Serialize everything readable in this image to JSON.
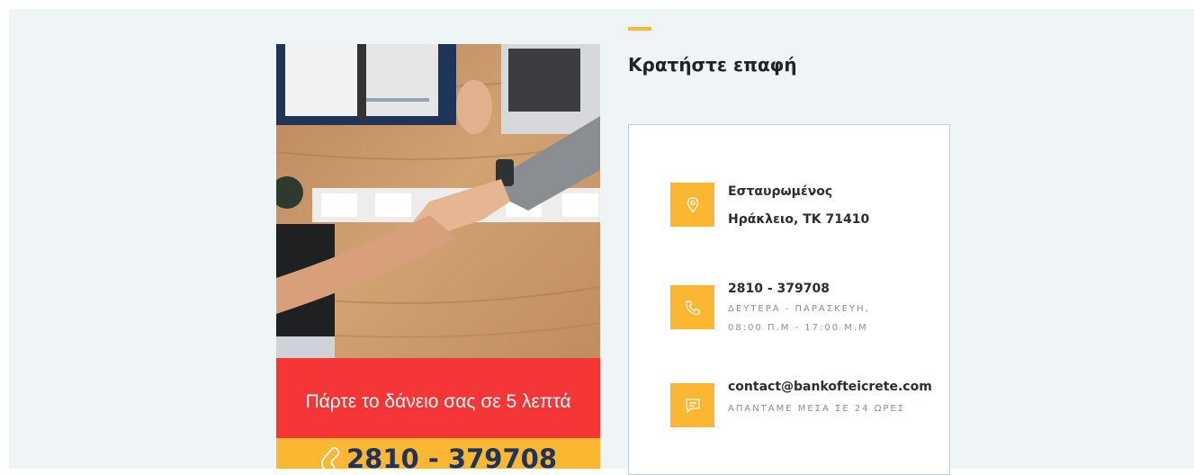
{
  "promo": {
    "tagline": "Πάρτε το δάνειο σας σε 5 λεπτά",
    "phone": "2810 - 379708",
    "colors": {
      "red": "#f43636",
      "yellow": "#fbb732",
      "phone_text": "#1d3461"
    }
  },
  "contact": {
    "title": "Κρατήστε επαφή",
    "accent_color": "#fbb732",
    "items": [
      {
        "icon": "location-pin-icon",
        "line1": "Εσταυρωμένος",
        "line2": "Ηράκλειο, ΤΚ 71410"
      },
      {
        "icon": "phone-icon",
        "line1": "2810 - 379708",
        "line2": "ΔΕΥΤΕΡΑ - ΠΑΡΑΣΚΕΥΗ,",
        "line3": "08:00 Π.Μ - 17:00 Μ.Μ"
      },
      {
        "icon": "chat-icon",
        "line1": "contact@bankofteicrete.com",
        "line2": "ΑΠΑΝΤΑΜΕ ΜΕΣΑ ΣΕ 24 ΩΡΕΣ"
      }
    ]
  }
}
